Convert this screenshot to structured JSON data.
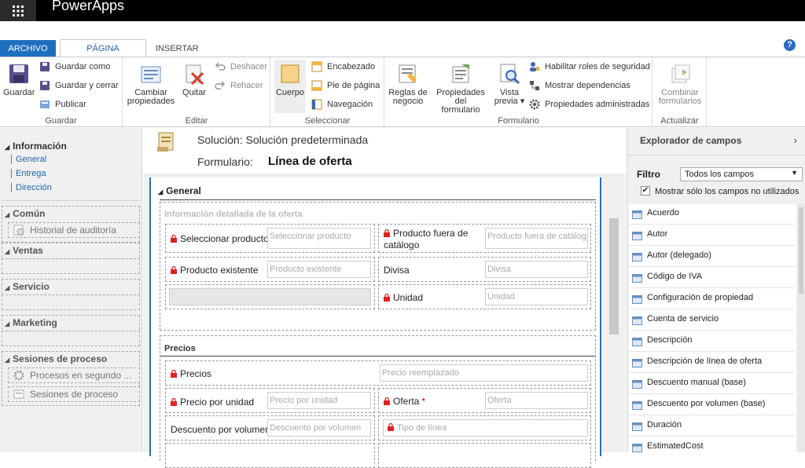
{
  "app": {
    "title": "PowerApps"
  },
  "tabs": [
    {
      "label": "ARCHIVO"
    },
    {
      "label": "PÁGINA PRINCIPAL"
    },
    {
      "label": "INSERTAR"
    }
  ],
  "help": "?",
  "ribbon": {
    "guardar": {
      "group": "Guardar",
      "save": "Guardar",
      "save_as": "Guardar como",
      "save_close": "Guardar y cerrar",
      "publish": "Publicar"
    },
    "editar": {
      "group": "Editar",
      "change_props_1": "Cambiar",
      "change_props_2": "propiedades",
      "remove": "Quitar",
      "undo": "Deshacer",
      "redo": "Rehacer"
    },
    "seleccionar": {
      "group": "Seleccionar",
      "body": "Cuerpo",
      "header": "Encabezado",
      "footer": "Pie de página",
      "nav": "Navegación"
    },
    "formulario": {
      "group": "Formulario",
      "rules_1": "Reglas de",
      "rules_2": "negocio",
      "formprops_1": "Propiedades del",
      "formprops_2": "formulario",
      "preview_1": "Vista",
      "preview_2": "previa ▾",
      "roles": "Habilitar roles de seguridad",
      "deps": "Mostrar dependencias",
      "managed": "Propiedades administradas"
    },
    "actualizar": {
      "group": "Actualizar",
      "merge_1": "Combinar",
      "merge_2": "formularios"
    }
  },
  "leftnav": {
    "info_title": "Información",
    "info_links": [
      "General",
      "Entrega",
      "Dirección"
    ],
    "comun": "Común",
    "historial": "Historial de auditoría",
    "ventas": "Ventas",
    "servicio": "Servicio",
    "marketing": "Marketing",
    "sesiones": "Sesiones de proceso",
    "procesos_bg": "Procesos en segundo ...",
    "sesiones_item": "Sesiones de proceso"
  },
  "header": {
    "solution_label": "Solución: Solución predeterminada",
    "form_label": "Formulario:",
    "form_name": "Línea de oferta"
  },
  "form": {
    "tab_title": "General",
    "section1_title": "Información detallada de la oferta",
    "select_product": {
      "label": "Seleccionar producto",
      "placeholder": "Seleccionar producto"
    },
    "writein": {
      "label_1": "Producto fuera de",
      "label_2": "catálogo",
      "placeholder": "Producto fuera de catálog"
    },
    "existing": {
      "label": "Producto existente",
      "placeholder": "Producto existente"
    },
    "currency": {
      "label": "Divisa",
      "placeholder": "Divisa"
    },
    "unit": {
      "label": "Unidad",
      "placeholder": "Unidad"
    },
    "section2_title": "Precios",
    "prices": {
      "label": "Precios",
      "placeholder": "Precio reemplazado"
    },
    "unit_price": {
      "label": "Precio por unidad",
      "placeholder": "Precio por unidad"
    },
    "quote": {
      "label": "Oferta",
      "required": "*",
      "placeholder": "Oferta"
    },
    "volume_discount": {
      "label": "Descuento por volumen",
      "placeholder": "Descuento por volumen"
    },
    "line_type": {
      "placeholder": "Tipo de línea"
    }
  },
  "explorer": {
    "title": "Explorador de campos",
    "arrow": "›",
    "filter_label": "Filtro",
    "filter_value": "Todos los campos",
    "only_unused": "Mostrar sólo los campos no utilizados",
    "fields": [
      "Acuerdo",
      "Autor",
      "Autor (delegado)",
      "Código de IVA",
      "Configuración de propiedad",
      "Cuenta de servicio",
      "Descripción",
      "Descripción de línea de oferta",
      "Descuento manual (base)",
      "Descuento por volumen (base)",
      "Duración",
      "EstimatedCost"
    ]
  }
}
